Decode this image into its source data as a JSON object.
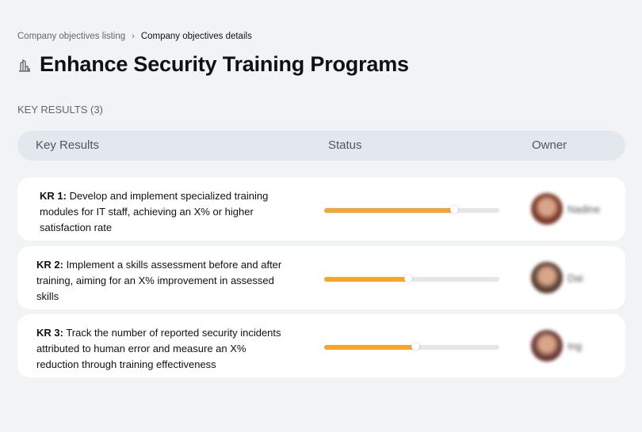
{
  "breadcrumb": {
    "items": [
      "Company objectives listing",
      "Company objectives details"
    ],
    "separator": "›"
  },
  "page": {
    "title": "Enhance Security Training Programs",
    "icon": "buildings-icon"
  },
  "key_results": {
    "heading": "KEY RESULTS (3)",
    "columns": [
      "Key Results",
      "Status",
      "Owner"
    ],
    "accent": "#f8a431",
    "rows": [
      {
        "label": "KR 1:",
        "text": " Develop and implement specialized training modules for IT staff, achieving an X% or higher satisfaction rate",
        "progress": 74,
        "owner": "Nadine",
        "avatar": "#7a3a2a"
      },
      {
        "label": "KR 2:",
        "text": " Implement a skills assessment before and after training, aiming for an X% improvement in assessed skills",
        "progress": 48,
        "owner": "Dai",
        "avatar": "#5a4030"
      },
      {
        "label": "KR 3:",
        "text": " Track the number of reported security incidents attributed to human error and measure an X% reduction through training effectiveness",
        "progress": 52,
        "owner": "Ing",
        "avatar": "#6b3a35"
      }
    ]
  }
}
